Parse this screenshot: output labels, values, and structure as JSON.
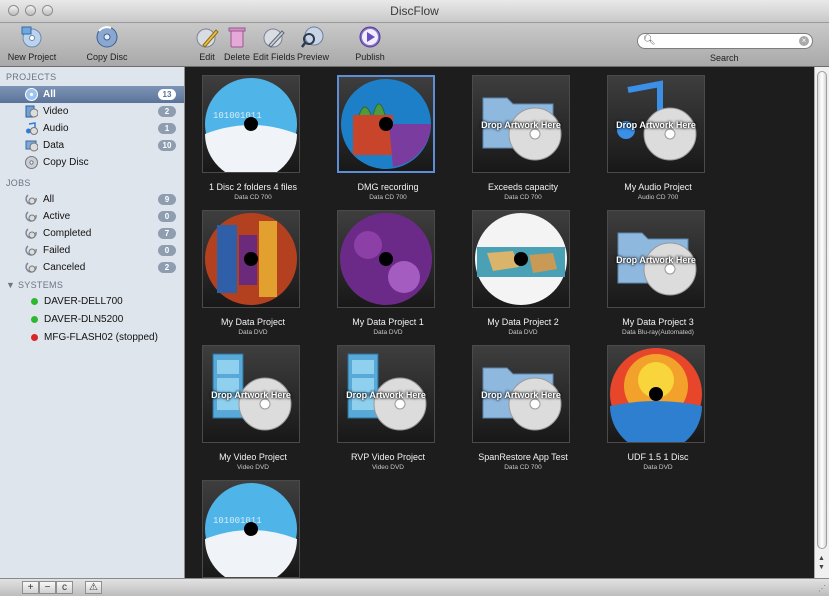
{
  "window": {
    "title": "DiscFlow"
  },
  "toolbar": {
    "new_project": "New Project",
    "copy_disc": "Copy Disc",
    "edit": "Edit",
    "delete": "Delete",
    "edit_fields": "Edit Fields",
    "preview": "Preview",
    "publish": "Publish",
    "search_placeholder": "",
    "search_label": "Search"
  },
  "sidebar": {
    "projects_header": "PROJECTS",
    "projects": [
      {
        "label": "All",
        "count": "13",
        "icon": "disc-icon",
        "selected": true
      },
      {
        "label": "Video",
        "count": "2",
        "icon": "film-icon"
      },
      {
        "label": "Audio",
        "count": "1",
        "icon": "music-icon"
      },
      {
        "label": "Data",
        "count": "10",
        "icon": "data-disc-icon"
      },
      {
        "label": "Copy Disc",
        "count": "",
        "icon": "copy-disc-icon"
      }
    ],
    "jobs_header": "JOBS",
    "jobs": [
      {
        "label": "All",
        "count": "9"
      },
      {
        "label": "Active",
        "count": "0"
      },
      {
        "label": "Completed",
        "count": "7"
      },
      {
        "label": "Failed",
        "count": "0"
      },
      {
        "label": "Canceled",
        "count": "2"
      }
    ],
    "systems_header": "▼ SYSTEMS",
    "systems": [
      {
        "label": "DAVER-DELL700",
        "status_color": "#2fb82f"
      },
      {
        "label": "DAVER-DLN5200",
        "status_color": "#2fb82f"
      },
      {
        "label": "MFG-FLASH02 (stopped)",
        "status_color": "#d92626"
      }
    ]
  },
  "bottom": {
    "add": "+",
    "remove": "−",
    "refresh": "c",
    "alert": "⚠"
  },
  "projects_grid": [
    {
      "name": "1 Disc 2 folders 4 files",
      "sub": "Data CD 700",
      "art": "binary-disc"
    },
    {
      "name": "DMG recording",
      "sub": "Data CD 700",
      "art": "cathedral-disc",
      "selected": true
    },
    {
      "name": "Exceeds capacity",
      "sub": "Data CD 700",
      "art": "folder",
      "drop": "Drop Artwork Here"
    },
    {
      "name": "My Audio Project",
      "sub": "Audio CD 700",
      "art": "music",
      "drop": "Drop Artwork Here"
    },
    {
      "name": "My Data Project",
      "sub": "Data DVD",
      "art": "stained-glass-disc"
    },
    {
      "name": "My Data Project 1",
      "sub": "Data DVD",
      "art": "purple-disc"
    },
    {
      "name": "My Data Project 2",
      "sub": "Data DVD",
      "art": "map-disc"
    },
    {
      "name": "My Data Project 3",
      "sub": "Data Blu-ray(Automated)",
      "art": "folder",
      "drop": "Drop Artwork Here"
    },
    {
      "name": "My Video Project",
      "sub": "Video DVD",
      "art": "film",
      "drop": "Drop Artwork Here"
    },
    {
      "name": "RVP Video Project",
      "sub": "Video DVD",
      "art": "film",
      "drop": "Drop Artwork Here"
    },
    {
      "name": "SpanRestore App Test",
      "sub": "Data CD 700",
      "art": "folder",
      "drop": "Drop Artwork Here"
    },
    {
      "name": "UDF 1.5 1 Disc",
      "sub": "Data DVD",
      "art": "orange-disc"
    },
    {
      "name": "",
      "sub": "",
      "art": "binary-disc"
    }
  ]
}
